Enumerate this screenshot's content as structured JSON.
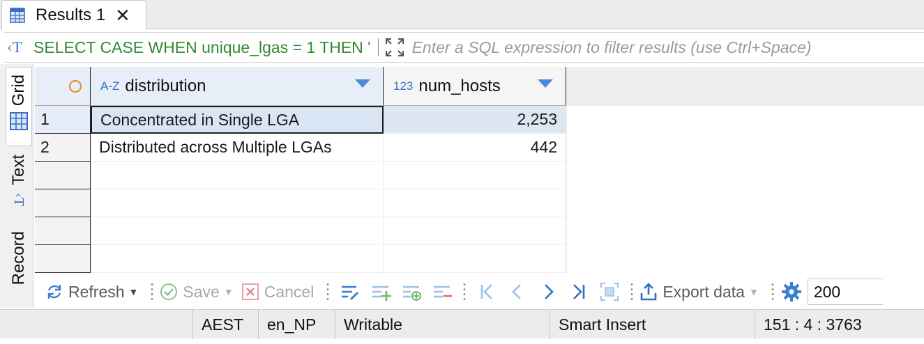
{
  "tab": {
    "label": "Results 1",
    "close_glyph": "✕",
    "icon": "grid-table-icon"
  },
  "filter": {
    "query_preview": "SELECT CASE WHEN unique_lgas = 1 THEN '",
    "placeholder": "Enter a SQL expression to filter results (use Ctrl+Space)"
  },
  "side_tabs": {
    "grid": "Grid",
    "text": "Text",
    "record": "Record"
  },
  "columns": [
    {
      "type_label": "A-Z",
      "name": "distribution"
    },
    {
      "type_label": "123",
      "name": "num_hosts"
    }
  ],
  "rows": [
    {
      "num": "1",
      "distribution": "Concentrated in Single LGA",
      "num_hosts": "2,253"
    },
    {
      "num": "2",
      "distribution": "Distributed across Multiple LGAs",
      "num_hosts": "442"
    }
  ],
  "toolbar": {
    "refresh": "Refresh",
    "save": "Save",
    "cancel": "Cancel",
    "export": "Export data",
    "fetch_size": "200"
  },
  "status": {
    "timezone": "AEST",
    "locale": "en_NP",
    "mode": "Writable",
    "insert_mode": "Smart Insert",
    "cursor": "151 : 4 : 3763"
  },
  "colors": {
    "accent": "#4a8bd6",
    "query_text": "#2f8a2f",
    "selection": "#d9e4f4",
    "header_bg": "#e7eef8"
  }
}
